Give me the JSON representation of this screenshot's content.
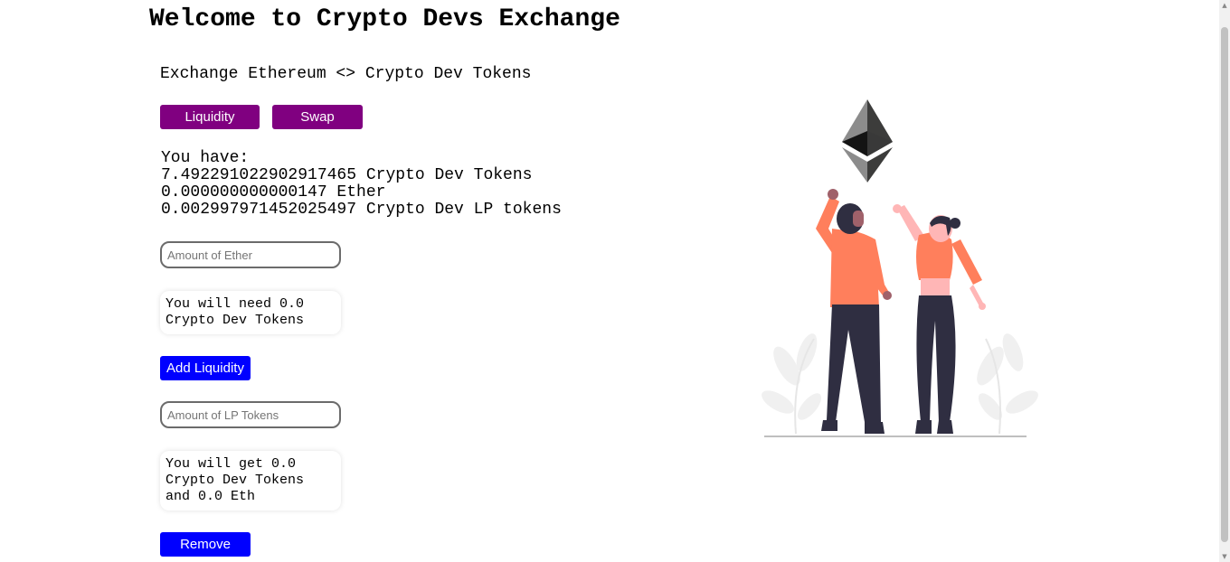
{
  "header": {
    "title": "Welcome to Crypto Devs Exchange"
  },
  "main": {
    "subtitle": "Exchange Ethereum <> Crypto Dev Tokens",
    "tabs": [
      {
        "label": "Liquidity"
      },
      {
        "label": "Swap"
      }
    ],
    "balances": {
      "heading": "You have:",
      "cd_tokens": "7.492291022902917465 Crypto Dev Tokens",
      "ether": "0.000000000000147 Ether",
      "lp_tokens": "0.002997971452025497 Crypto Dev LP tokens"
    },
    "add_liquidity": {
      "placeholder": "Amount of Ether",
      "info": "You will need 0.0 Crypto Dev Tokens",
      "button_label": "Add Liquidity"
    },
    "remove_liquidity": {
      "placeholder": "Amount of LP Tokens",
      "info": "You will get 0.0 Crypto Dev Tokens and 0.0 Eth",
      "button_label": "Remove"
    }
  },
  "colors": {
    "tab_button": "#800080",
    "action_button": "#0000ff",
    "shirt": "#ff7f5c",
    "pants": "#2f2e41"
  },
  "icons": {
    "illustration": "people-celebrating-ethereum-illustration",
    "logo": "ethereum-logo-icon"
  }
}
